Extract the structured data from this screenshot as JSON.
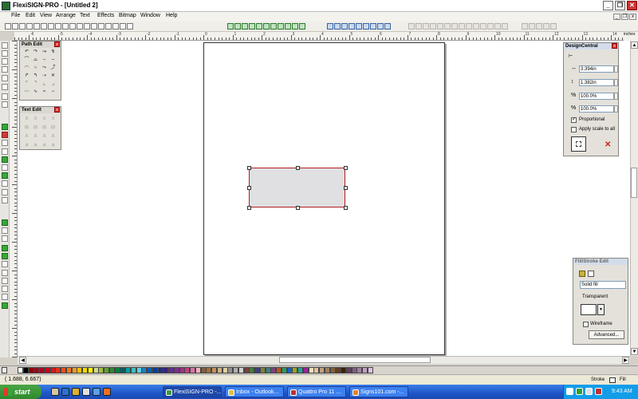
{
  "window": {
    "title": "FlexiSIGN-PRO - [Untitled 2]",
    "minimize": "_",
    "restore": "❐",
    "close": "✕",
    "mdi_minimize": "_",
    "mdi_restore": "❐",
    "mdi_close": "x"
  },
  "menu": [
    "File",
    "Edit",
    "View",
    "Arrange",
    "Text",
    "Effects",
    "Bitmap",
    "Window",
    "Help"
  ],
  "ruler": {
    "units": "inches",
    "labels": [
      "-6",
      "-5",
      "-4",
      "-3",
      "-2",
      "-1",
      "0",
      "1",
      "2",
      "3",
      "4",
      "5",
      "6",
      "7",
      "8",
      "9",
      "10",
      "11",
      "12",
      "13",
      "14"
    ]
  },
  "path_edit": {
    "title": "Path Edit",
    "close": "x"
  },
  "text_edit": {
    "title": "Text Edit",
    "close": "x"
  },
  "design_central": {
    "title": "DesignCentral",
    "width_value": "3.394in",
    "height_value": "1.382in",
    "scale_w": "100.0%",
    "scale_h": "100.0%",
    "proportional_label": "Proportional",
    "proportional_checked": "✓",
    "apply_scale_label": "Apply scale to all",
    "cancel_glyph": "✕",
    "close": "x"
  },
  "fill_stroke": {
    "title": "Fill/Stroke Edit",
    "fill_type": "Solid fill",
    "transparent_label": "Transparent",
    "wireframe_label": "Wireframe",
    "advanced_label": "Advanced...",
    "dropdown_arrow": "▼"
  },
  "status": {
    "coords": "( 1.688,    6.667)",
    "stroke_label": "Stroke",
    "fill_label": "Fill"
  },
  "taskbar": {
    "start_label": "start",
    "tasks": [
      "FlexiSIGN-PRO -...",
      "Inbox - Outlook...",
      "Quattro Pro 11 ...",
      "Signs101.com -..."
    ],
    "clock": "9:43 AM"
  },
  "palette_colors": [
    "#ffffff",
    "#000000",
    "#8b0000",
    "#a0001a",
    "#b00020",
    "#c8001e",
    "#d01a1a",
    "#e03020",
    "#e85020",
    "#f07820",
    "#f09a28",
    "#f8c000",
    "#f0d800",
    "#ffff00",
    "#d0d890",
    "#a0c040",
    "#60a030",
    "#2e8a2e",
    "#008040",
    "#006060",
    "#00a0a0",
    "#40c0c0",
    "#60d0e0",
    "#2080c0",
    "#0060b0",
    "#0040a0",
    "#203080",
    "#402080",
    "#603090",
    "#803090",
    "#a03080",
    "#c04080",
    "#e070a0",
    "#f0b0c0",
    "#806040",
    "#a07040",
    "#c09060",
    "#d0b080",
    "#e0d0a0",
    "#909090",
    "#b0b0b0",
    "#d0d0d0",
    "#7f3f3f",
    "#3f7f3f",
    "#3f3f7f",
    "#7f7f3f",
    "#3f7f7f",
    "#7f3f7f",
    "#c05020",
    "#20a060",
    "#2060c0",
    "#a0a020",
    "#20a0a0",
    "#a020a0",
    "#f0e0c0",
    "#e0c0a0",
    "#c0a080",
    "#a08060",
    "#806040",
    "#604020",
    "#402000",
    "#604060",
    "#806080",
    "#a080a0",
    "#c0a0c0",
    "#e0c0e0"
  ],
  "colors": {
    "selection": "#b21d1d",
    "rect_fill": "#e0dfe2"
  }
}
